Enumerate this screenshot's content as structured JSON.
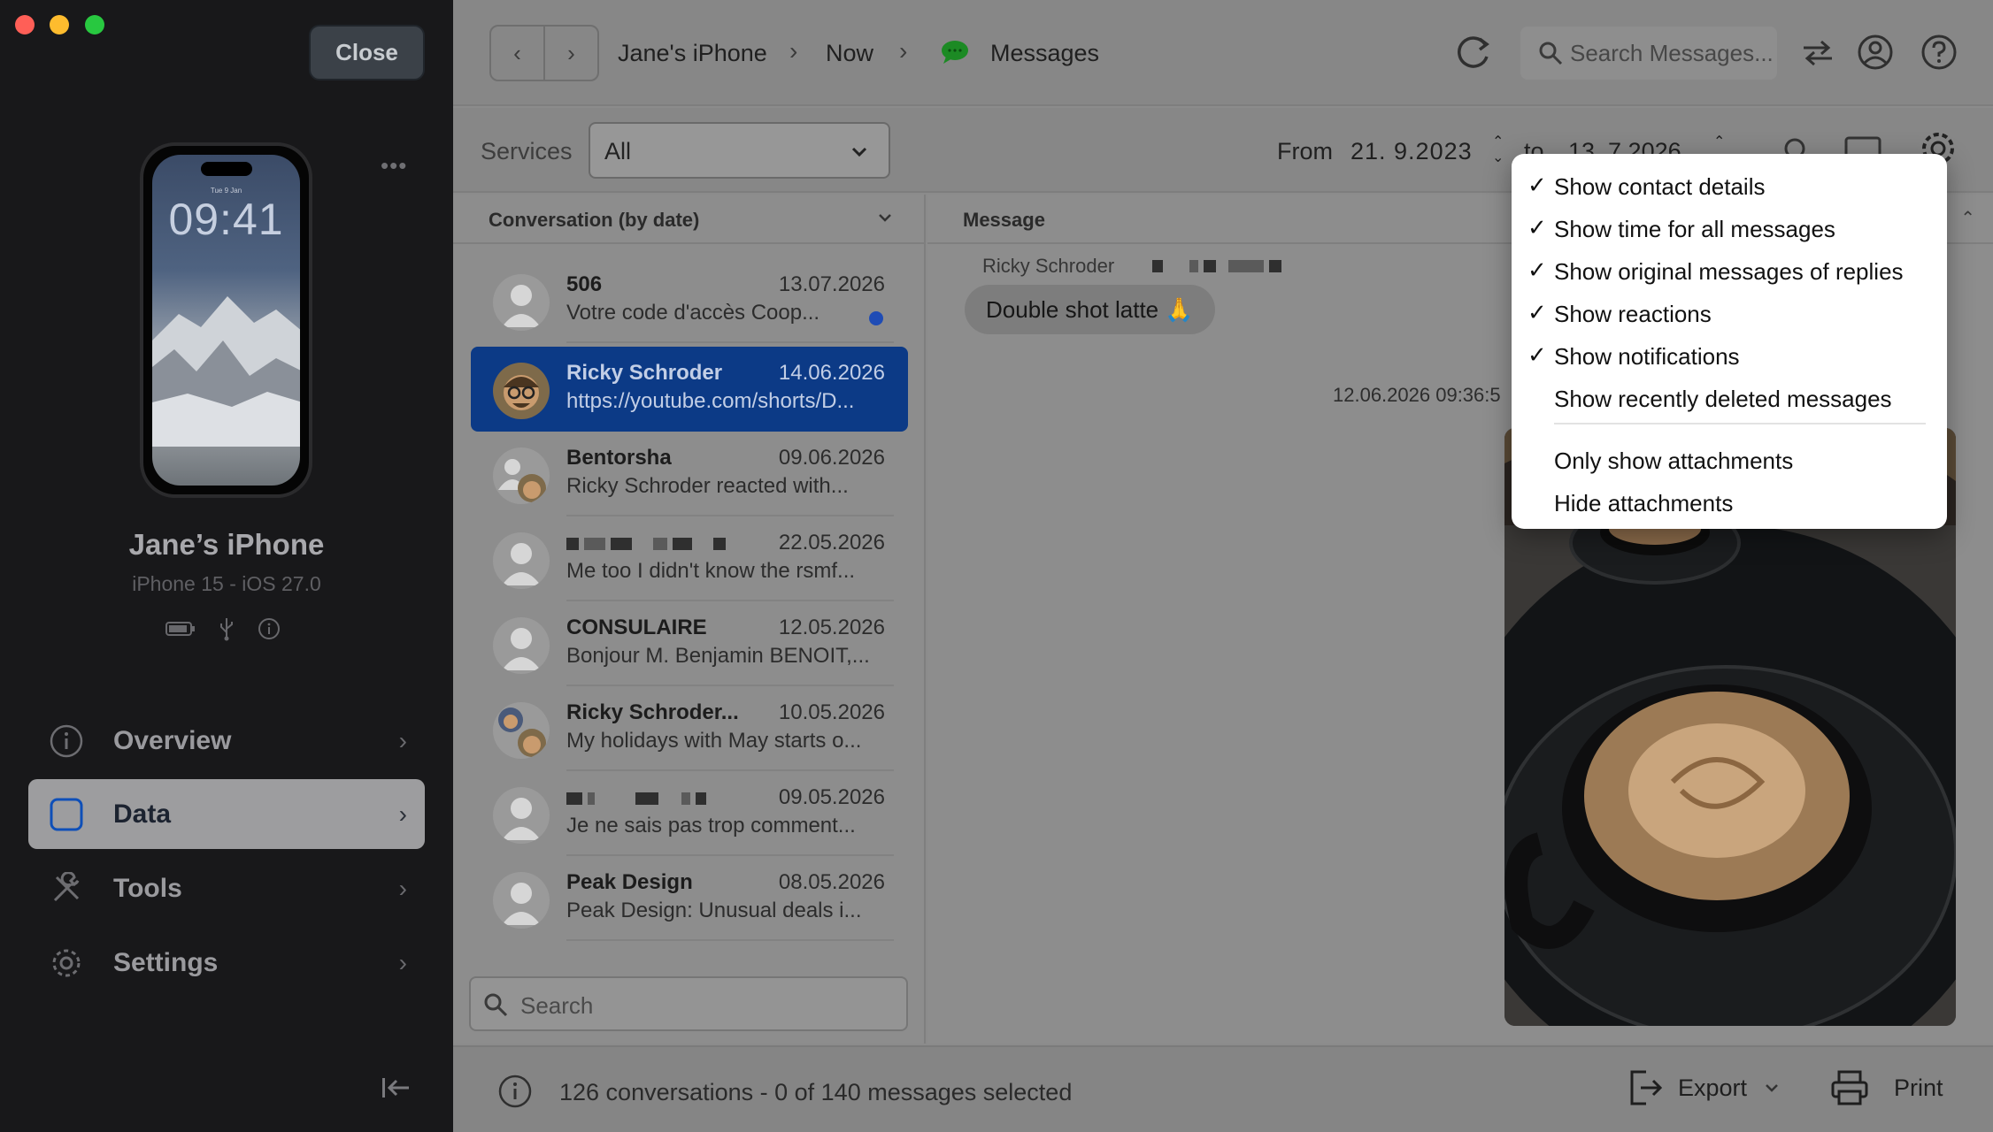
{
  "window": {
    "close_label": "Close",
    "traffic_colors": [
      "#ff5f57",
      "#febc2e",
      "#28c840"
    ]
  },
  "device": {
    "lock_date": "Tue 9 Jan",
    "lock_time": "09:41",
    "name": "Jane’s iPhone",
    "model": "iPhone 15 - iOS 27.0"
  },
  "sidebar": {
    "nav": [
      {
        "label": "Overview",
        "icon": "info-icon",
        "active": false
      },
      {
        "label": "Data",
        "icon": "data-square-icon",
        "active": true
      },
      {
        "label": "Tools",
        "icon": "tools-icon",
        "active": false
      },
      {
        "label": "Settings",
        "icon": "gear-icon",
        "active": false
      }
    ]
  },
  "toolbar": {
    "breadcrumb": [
      "Jane's iPhone",
      "Now",
      "Messages"
    ],
    "search_placeholder": "Search Messages..."
  },
  "filters": {
    "services_label": "Services",
    "services_value": "All",
    "from_label": "From",
    "from_date": "21. 9.2023",
    "to_label": "to",
    "to_date": "13. 7.2026"
  },
  "conversations": {
    "header": "Conversation (by date)",
    "rows": [
      {
        "name": "506",
        "date": "13.07.2026",
        "preview": "Votre code d'accès Coop...",
        "unread": true
      },
      {
        "name": "Ricky Schroder",
        "date": "14.06.2026",
        "preview": "https://youtube.com/shorts/D...",
        "selected": true
      },
      {
        "name": "Bentorsha",
        "date": "09.06.2026",
        "preview": "Ricky Schroder reacted with..."
      },
      {
        "name": "",
        "date": "22.05.2026",
        "preview": "Me too I didn't know the rsmf..."
      },
      {
        "name": "CONSULAIRE",
        "date": "12.05.2026",
        "preview": "Bonjour M. Benjamin BENOIT,..."
      },
      {
        "name": "Ricky Schroder...",
        "date": "10.05.2026",
        "preview": "My holidays with May starts o..."
      },
      {
        "name": "",
        "date": "09.05.2026",
        "preview": "Je ne sais pas trop comment..."
      },
      {
        "name": "Peak Design",
        "date": "08.05.2026",
        "preview": "Peak Design: Unusual deals i..."
      }
    ],
    "search_placeholder": "Search"
  },
  "messages": {
    "header": "Message",
    "sender": "Ricky Schroder",
    "bubble_text": "Double shot latte 🙏",
    "timestamp": "12.06.2026 09:36:5"
  },
  "status": {
    "text": "126 conversations - 0 of 140 messages selected",
    "export_label": "Export",
    "print_label": "Print"
  },
  "settings_menu": {
    "items": [
      {
        "label": "Show contact details",
        "checked": true
      },
      {
        "label": "Show time for all messages",
        "checked": true
      },
      {
        "label": "Show original messages of replies",
        "checked": true
      },
      {
        "label": "Show reactions",
        "checked": true
      },
      {
        "label": "Show notifications",
        "checked": true
      },
      {
        "label": "Show recently deleted messages",
        "checked": false
      }
    ],
    "items2": [
      {
        "label": "Only show attachments",
        "checked": false
      },
      {
        "label": "Hide attachments",
        "checked": false
      }
    ],
    "check_glyph": "✓"
  }
}
